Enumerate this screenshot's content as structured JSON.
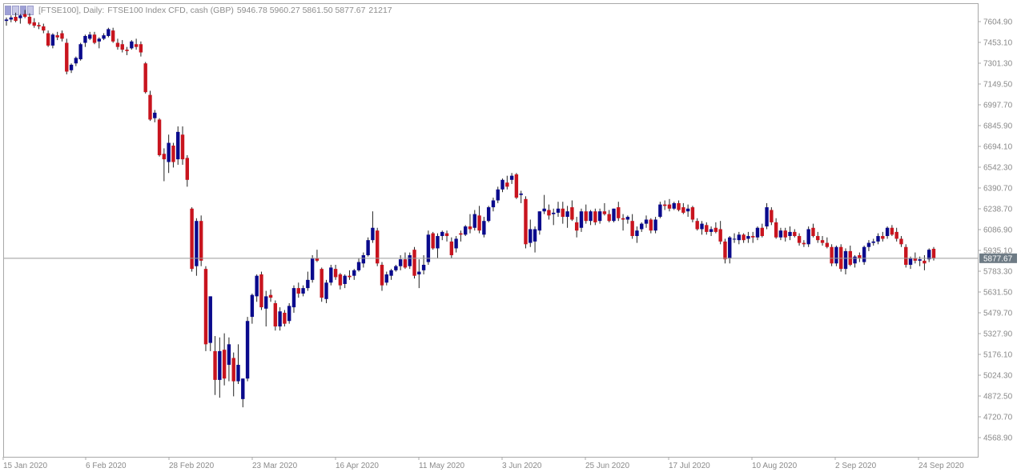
{
  "header": {
    "symbol_period": "[FTSE100], Daily:",
    "description": "FTSE100 Index CFD, cash (GBP)",
    "ohlc": "5946.78 5960.27 5861.50 5877.67",
    "volume": "21217"
  },
  "price_label": "5877.67",
  "colors": {
    "bull": "#0a0a8c",
    "bear": "#c8141e",
    "wick": "#222222",
    "grid_line": "#9a9a9a",
    "price_tag": "#6e7b85"
  },
  "chart_data": {
    "type": "candlestick",
    "title": "FTSE100 Index CFD, cash (GBP)",
    "ylim": [
      4480,
      7700
    ],
    "current_price": 5877.67,
    "y_ticks": [
      "7604.90",
      "7453.10",
      "7301.30",
      "7149.50",
      "6997.70",
      "6845.90",
      "6694.10",
      "6542.30",
      "6390.70",
      "6238.70",
      "6086.90",
      "5935.10",
      "5783.30",
      "5631.50",
      "5479.70",
      "5327.90",
      "5176.10",
      "5024.30",
      "4872.50",
      "4720.70",
      "4568.90"
    ],
    "x_ticks": [
      "15 Jan 2020",
      "6 Feb 2020",
      "28 Feb 2020",
      "23 Mar 2020",
      "16 Apr 2020",
      "11 May 2020",
      "3 Jun 2020",
      "25 Jun 2020",
      "17 Jul 2020",
      "10 Aug 2020",
      "2 Sep 2020",
      "24 Sep 2020"
    ],
    "candles": [
      {
        "o": 7610,
        "h": 7635,
        "l": 7575,
        "c": 7620
      },
      {
        "o": 7620,
        "h": 7650,
        "l": 7600,
        "c": 7635
      },
      {
        "o": 7640,
        "h": 7670,
        "l": 7600,
        "c": 7610
      },
      {
        "o": 7630,
        "h": 7660,
        "l": 7590,
        "c": 7650
      },
      {
        "o": 7660,
        "h": 7690,
        "l": 7630,
        "c": 7640
      },
      {
        "o": 7640,
        "h": 7665,
        "l": 7580,
        "c": 7590
      },
      {
        "o": 7600,
        "h": 7630,
        "l": 7560,
        "c": 7575
      },
      {
        "o": 7580,
        "h": 7600,
        "l": 7550,
        "c": 7570
      },
      {
        "o": 7570,
        "h": 7590,
        "l": 7520,
        "c": 7540
      },
      {
        "o": 7520,
        "h": 7540,
        "l": 7420,
        "c": 7430
      },
      {
        "o": 7430,
        "h": 7520,
        "l": 7410,
        "c": 7510
      },
      {
        "o": 7505,
        "h": 7530,
        "l": 7470,
        "c": 7490
      },
      {
        "o": 7520,
        "h": 7540,
        "l": 7460,
        "c": 7480
      },
      {
        "o": 7450,
        "h": 7480,
        "l": 7220,
        "c": 7240
      },
      {
        "o": 7250,
        "h": 7300,
        "l": 7230,
        "c": 7290
      },
      {
        "o": 7300,
        "h": 7350,
        "l": 7280,
        "c": 7340
      },
      {
        "o": 7330,
        "h": 7450,
        "l": 7320,
        "c": 7440
      },
      {
        "o": 7450,
        "h": 7510,
        "l": 7420,
        "c": 7500
      },
      {
        "o": 7480,
        "h": 7530,
        "l": 7470,
        "c": 7510
      },
      {
        "o": 7510,
        "h": 7530,
        "l": 7440,
        "c": 7450
      },
      {
        "o": 7460,
        "h": 7490,
        "l": 7410,
        "c": 7480
      },
      {
        "o": 7480,
        "h": 7520,
        "l": 7470,
        "c": 7505
      },
      {
        "o": 7500,
        "h": 7560,
        "l": 7490,
        "c": 7550
      },
      {
        "o": 7540,
        "h": 7560,
        "l": 7450,
        "c": 7460
      },
      {
        "o": 7450,
        "h": 7480,
        "l": 7400,
        "c": 7420
      },
      {
        "o": 7440,
        "h": 7470,
        "l": 7380,
        "c": 7400
      },
      {
        "o": 7400,
        "h": 7420,
        "l": 7360,
        "c": 7390
      },
      {
        "o": 7410,
        "h": 7470,
        "l": 7400,
        "c": 7460
      },
      {
        "o": 7440,
        "h": 7480,
        "l": 7400,
        "c": 7420
      },
      {
        "o": 7440,
        "h": 7460,
        "l": 7350,
        "c": 7380
      },
      {
        "o": 7300,
        "h": 7310,
        "l": 7080,
        "c": 7090
      },
      {
        "o": 7070,
        "h": 7100,
        "l": 6880,
        "c": 6890
      },
      {
        "o": 6900,
        "h": 6960,
        "l": 6870,
        "c": 6940
      },
      {
        "o": 6890,
        "h": 6900,
        "l": 6620,
        "c": 6630
      },
      {
        "o": 6640,
        "h": 6680,
        "l": 6440,
        "c": 6600
      },
      {
        "o": 6580,
        "h": 6780,
        "l": 6500,
        "c": 6720
      },
      {
        "o": 6700,
        "h": 6720,
        "l": 6540,
        "c": 6580
      },
      {
        "o": 6600,
        "h": 6840,
        "l": 6560,
        "c": 6800
      },
      {
        "o": 6780,
        "h": 6840,
        "l": 6560,
        "c": 6600
      },
      {
        "o": 6610,
        "h": 6630,
        "l": 6400,
        "c": 6450
      },
      {
        "o": 6240,
        "h": 6250,
        "l": 5780,
        "c": 5800
      },
      {
        "o": 5820,
        "h": 6170,
        "l": 5750,
        "c": 6150
      },
      {
        "o": 6150,
        "h": 6190,
        "l": 5820,
        "c": 5860
      },
      {
        "o": 5800,
        "h": 5820,
        "l": 5200,
        "c": 5250
      },
      {
        "o": 5260,
        "h": 5600,
        "l": 5200,
        "c": 5600
      },
      {
        "o": 5200,
        "h": 5310,
        "l": 4880,
        "c": 4990
      },
      {
        "o": 4990,
        "h": 5300,
        "l": 4860,
        "c": 5200
      },
      {
        "o": 5210,
        "h": 5330,
        "l": 4950,
        "c": 5000
      },
      {
        "o": 5100,
        "h": 5300,
        "l": 4980,
        "c": 5250
      },
      {
        "o": 5150,
        "h": 5190,
        "l": 4870,
        "c": 4980
      },
      {
        "o": 4980,
        "h": 5250,
        "l": 4960,
        "c": 5100
      },
      {
        "o": 4850,
        "h": 5000,
        "l": 4790,
        "c": 5000
      },
      {
        "o": 5000,
        "h": 5450,
        "l": 4980,
        "c": 5420
      },
      {
        "o": 5450,
        "h": 5620,
        "l": 5400,
        "c": 5610
      },
      {
        "o": 5600,
        "h": 5760,
        "l": 5560,
        "c": 5750
      },
      {
        "o": 5760,
        "h": 5780,
        "l": 5500,
        "c": 5520
      },
      {
        "o": 5510,
        "h": 5640,
        "l": 5380,
        "c": 5600
      },
      {
        "o": 5610,
        "h": 5650,
        "l": 5560,
        "c": 5590
      },
      {
        "o": 5550,
        "h": 5570,
        "l": 5350,
        "c": 5380
      },
      {
        "o": 5380,
        "h": 5520,
        "l": 5350,
        "c": 5490
      },
      {
        "o": 5480,
        "h": 5500,
        "l": 5380,
        "c": 5400
      },
      {
        "o": 5420,
        "h": 5550,
        "l": 5400,
        "c": 5530
      },
      {
        "o": 5520,
        "h": 5680,
        "l": 5480,
        "c": 5660
      },
      {
        "o": 5660,
        "h": 5700,
        "l": 5590,
        "c": 5620
      },
      {
        "o": 5620,
        "h": 5680,
        "l": 5600,
        "c": 5660
      },
      {
        "o": 5660,
        "h": 5780,
        "l": 5640,
        "c": 5720
      },
      {
        "o": 5720,
        "h": 5900,
        "l": 5700,
        "c": 5880
      },
      {
        "o": 5880,
        "h": 5940,
        "l": 5850,
        "c": 5860
      },
      {
        "o": 5800,
        "h": 5810,
        "l": 5560,
        "c": 5590
      },
      {
        "o": 5580,
        "h": 5720,
        "l": 5550,
        "c": 5700
      },
      {
        "o": 5700,
        "h": 5830,
        "l": 5680,
        "c": 5810
      },
      {
        "o": 5800,
        "h": 5830,
        "l": 5720,
        "c": 5740
      },
      {
        "o": 5760,
        "h": 5770,
        "l": 5650,
        "c": 5680
      },
      {
        "o": 5690,
        "h": 5760,
        "l": 5660,
        "c": 5750
      },
      {
        "o": 5750,
        "h": 5790,
        "l": 5720,
        "c": 5740
      },
      {
        "o": 5750,
        "h": 5800,
        "l": 5720,
        "c": 5790
      },
      {
        "o": 5790,
        "h": 5880,
        "l": 5780,
        "c": 5850
      },
      {
        "o": 5840,
        "h": 5920,
        "l": 5810,
        "c": 5900
      },
      {
        "o": 5900,
        "h": 6030,
        "l": 5890,
        "c": 6010
      },
      {
        "o": 6010,
        "h": 6220,
        "l": 5990,
        "c": 6100
      },
      {
        "o": 6080,
        "h": 6100,
        "l": 5820,
        "c": 5840
      },
      {
        "o": 5830,
        "h": 5850,
        "l": 5640,
        "c": 5680
      },
      {
        "o": 5700,
        "h": 5780,
        "l": 5680,
        "c": 5760
      },
      {
        "o": 5750,
        "h": 5800,
        "l": 5720,
        "c": 5790
      },
      {
        "o": 5790,
        "h": 5830,
        "l": 5780,
        "c": 5820
      },
      {
        "o": 5820,
        "h": 5900,
        "l": 5790,
        "c": 5870
      },
      {
        "o": 5870,
        "h": 5920,
        "l": 5800,
        "c": 5810
      },
      {
        "o": 5820,
        "h": 5920,
        "l": 5800,
        "c": 5900
      },
      {
        "o": 5940,
        "h": 5960,
        "l": 5730,
        "c": 5750
      },
      {
        "o": 5760,
        "h": 5870,
        "l": 5660,
        "c": 5780
      },
      {
        "o": 5790,
        "h": 5900,
        "l": 5760,
        "c": 5830
      },
      {
        "o": 5850,
        "h": 6080,
        "l": 5830,
        "c": 6050
      },
      {
        "o": 6060,
        "h": 6070,
        "l": 5940,
        "c": 5950
      },
      {
        "o": 5950,
        "h": 6060,
        "l": 5880,
        "c": 6040
      },
      {
        "o": 6040,
        "h": 6080,
        "l": 6010,
        "c": 6070
      },
      {
        "o": 6060,
        "h": 6080,
        "l": 6000,
        "c": 6040
      },
      {
        "o": 6000,
        "h": 6030,
        "l": 5880,
        "c": 5900
      },
      {
        "o": 5950,
        "h": 6040,
        "l": 5920,
        "c": 6020
      },
      {
        "o": 6060,
        "h": 6080,
        "l": 6000,
        "c": 6050
      },
      {
        "o": 6050,
        "h": 6120,
        "l": 6040,
        "c": 6110
      },
      {
        "o": 6110,
        "h": 6200,
        "l": 6060,
        "c": 6090
      },
      {
        "o": 6100,
        "h": 6230,
        "l": 6080,
        "c": 6200
      },
      {
        "o": 6190,
        "h": 6260,
        "l": 6060,
        "c": 6080
      },
      {
        "o": 6050,
        "h": 6180,
        "l": 6030,
        "c": 6150
      },
      {
        "o": 6150,
        "h": 6260,
        "l": 6140,
        "c": 6250
      },
      {
        "o": 6250,
        "h": 6320,
        "l": 6220,
        "c": 6300
      },
      {
        "o": 6300,
        "h": 6400,
        "l": 6280,
        "c": 6380
      },
      {
        "o": 6380,
        "h": 6460,
        "l": 6360,
        "c": 6450
      },
      {
        "o": 6430,
        "h": 6480,
        "l": 6380,
        "c": 6400
      },
      {
        "o": 6450,
        "h": 6500,
        "l": 6420,
        "c": 6480
      },
      {
        "o": 6490,
        "h": 6500,
        "l": 6310,
        "c": 6320
      },
      {
        "o": 6340,
        "h": 6370,
        "l": 6280,
        "c": 6350
      },
      {
        "o": 6310,
        "h": 6330,
        "l": 5950,
        "c": 5980
      },
      {
        "o": 5990,
        "h": 6160,
        "l": 5960,
        "c": 6090
      },
      {
        "o": 6000,
        "h": 6110,
        "l": 5920,
        "c": 6090
      },
      {
        "o": 6080,
        "h": 6220,
        "l": 6050,
        "c": 6220
      },
      {
        "o": 6220,
        "h": 6340,
        "l": 6200,
        "c": 6240
      },
      {
        "o": 6230,
        "h": 6270,
        "l": 6160,
        "c": 6190
      },
      {
        "o": 6200,
        "h": 6240,
        "l": 6120,
        "c": 6210
      },
      {
        "o": 6210,
        "h": 6290,
        "l": 6180,
        "c": 6240
      },
      {
        "o": 6240,
        "h": 6290,
        "l": 6130,
        "c": 6180
      },
      {
        "o": 6180,
        "h": 6260,
        "l": 6100,
        "c": 6220
      },
      {
        "o": 6250,
        "h": 6300,
        "l": 6150,
        "c": 6160
      },
      {
        "o": 6140,
        "h": 6180,
        "l": 6030,
        "c": 6080
      },
      {
        "o": 6100,
        "h": 6240,
        "l": 6070,
        "c": 6220
      },
      {
        "o": 6220,
        "h": 6270,
        "l": 6130,
        "c": 6150
      },
      {
        "o": 6150,
        "h": 6230,
        "l": 6120,
        "c": 6220
      },
      {
        "o": 6220,
        "h": 6240,
        "l": 6120,
        "c": 6140
      },
      {
        "o": 6150,
        "h": 6240,
        "l": 6130,
        "c": 6220
      },
      {
        "o": 6220,
        "h": 6280,
        "l": 6190,
        "c": 6200
      },
      {
        "o": 6200,
        "h": 6230,
        "l": 6140,
        "c": 6150
      },
      {
        "o": 6150,
        "h": 6240,
        "l": 6140,
        "c": 6240
      },
      {
        "o": 6250,
        "h": 6290,
        "l": 6150,
        "c": 6170
      },
      {
        "o": 6170,
        "h": 6200,
        "l": 6080,
        "c": 6160
      },
      {
        "o": 6160,
        "h": 6190,
        "l": 6130,
        "c": 6180
      },
      {
        "o": 6150,
        "h": 6200,
        "l": 6020,
        "c": 6040
      },
      {
        "o": 6040,
        "h": 6110,
        "l": 5990,
        "c": 6080
      },
      {
        "o": 6090,
        "h": 6140,
        "l": 6070,
        "c": 6130
      },
      {
        "o": 6130,
        "h": 6190,
        "l": 6100,
        "c": 6160
      },
      {
        "o": 6160,
        "h": 6170,
        "l": 6060,
        "c": 6080
      },
      {
        "o": 6080,
        "h": 6180,
        "l": 6060,
        "c": 6160
      },
      {
        "o": 6180,
        "h": 6290,
        "l": 6170,
        "c": 6270
      },
      {
        "o": 6270,
        "h": 6300,
        "l": 6230,
        "c": 6260
      },
      {
        "o": 6270,
        "h": 6310,
        "l": 6220,
        "c": 6240
      },
      {
        "o": 6240,
        "h": 6290,
        "l": 6230,
        "c": 6280
      },
      {
        "o": 6280,
        "h": 6300,
        "l": 6220,
        "c": 6230
      },
      {
        "o": 6250,
        "h": 6280,
        "l": 6200,
        "c": 6210
      },
      {
        "o": 6220,
        "h": 6270,
        "l": 6180,
        "c": 6240
      },
      {
        "o": 6250,
        "h": 6260,
        "l": 6140,
        "c": 6160
      },
      {
        "o": 6150,
        "h": 6170,
        "l": 6080,
        "c": 6090
      },
      {
        "o": 6090,
        "h": 6150,
        "l": 6050,
        "c": 6130
      },
      {
        "o": 6120,
        "h": 6140,
        "l": 6050,
        "c": 6070
      },
      {
        "o": 6070,
        "h": 6110,
        "l": 6040,
        "c": 6090
      },
      {
        "o": 6100,
        "h": 6140,
        "l": 6060,
        "c": 6070
      },
      {
        "o": 6090,
        "h": 6150,
        "l": 5980,
        "c": 6000
      },
      {
        "o": 6000,
        "h": 6020,
        "l": 5840,
        "c": 5870
      },
      {
        "o": 5880,
        "h": 6040,
        "l": 5840,
        "c": 6030
      },
      {
        "o": 6020,
        "h": 6060,
        "l": 5990,
        "c": 6020
      },
      {
        "o": 6010,
        "h": 6070,
        "l": 5980,
        "c": 6050
      },
      {
        "o": 6050,
        "h": 6060,
        "l": 5990,
        "c": 6010
      },
      {
        "o": 6020,
        "h": 6070,
        "l": 5990,
        "c": 6040
      },
      {
        "o": 6040,
        "h": 6070,
        "l": 5990,
        "c": 6030
      },
      {
        "o": 6030,
        "h": 6110,
        "l": 6010,
        "c": 6100
      },
      {
        "o": 6100,
        "h": 6130,
        "l": 6030,
        "c": 6040
      },
      {
        "o": 6110,
        "h": 6280,
        "l": 6090,
        "c": 6250
      },
      {
        "o": 6230,
        "h": 6250,
        "l": 6120,
        "c": 6140
      },
      {
        "o": 6140,
        "h": 6170,
        "l": 6020,
        "c": 6030
      },
      {
        "o": 6030,
        "h": 6100,
        "l": 6010,
        "c": 6080
      },
      {
        "o": 6080,
        "h": 6100,
        "l": 6000,
        "c": 6030
      },
      {
        "o": 6040,
        "h": 6110,
        "l": 6010,
        "c": 6070
      },
      {
        "o": 6070,
        "h": 6090,
        "l": 6030,
        "c": 6040
      },
      {
        "o": 6040,
        "h": 6060,
        "l": 5970,
        "c": 5990
      },
      {
        "o": 5990,
        "h": 6010,
        "l": 5960,
        "c": 5980
      },
      {
        "o": 5980,
        "h": 6110,
        "l": 5960,
        "c": 6090
      },
      {
        "o": 6100,
        "h": 6130,
        "l": 6030,
        "c": 6040
      },
      {
        "o": 6040,
        "h": 6070,
        "l": 5990,
        "c": 6010
      },
      {
        "o": 6010,
        "h": 6040,
        "l": 5970,
        "c": 5990
      },
      {
        "o": 5990,
        "h": 6030,
        "l": 5950,
        "c": 5960
      },
      {
        "o": 5960,
        "h": 5980,
        "l": 5820,
        "c": 5840
      },
      {
        "o": 5840,
        "h": 5970,
        "l": 5820,
        "c": 5960
      },
      {
        "o": 5960,
        "h": 5980,
        "l": 5780,
        "c": 5800
      },
      {
        "o": 5800,
        "h": 5950,
        "l": 5760,
        "c": 5930
      },
      {
        "o": 5930,
        "h": 5970,
        "l": 5820,
        "c": 5830
      },
      {
        "o": 5840,
        "h": 5900,
        "l": 5810,
        "c": 5890
      },
      {
        "o": 5900,
        "h": 5920,
        "l": 5850,
        "c": 5880
      },
      {
        "o": 5850,
        "h": 5970,
        "l": 5830,
        "c": 5960
      },
      {
        "o": 5960,
        "h": 6010,
        "l": 5930,
        "c": 5990
      },
      {
        "o": 5990,
        "h": 6020,
        "l": 5970,
        "c": 6000
      },
      {
        "o": 6000,
        "h": 6060,
        "l": 5980,
        "c": 6040
      },
      {
        "o": 6040,
        "h": 6070,
        "l": 6000,
        "c": 6020
      },
      {
        "o": 6040,
        "h": 6110,
        "l": 6020,
        "c": 6100
      },
      {
        "o": 6100,
        "h": 6120,
        "l": 6040,
        "c": 6050
      },
      {
        "o": 6070,
        "h": 6100,
        "l": 6000,
        "c": 6020
      },
      {
        "o": 6020,
        "h": 6040,
        "l": 5960,
        "c": 5980
      },
      {
        "o": 5960,
        "h": 5980,
        "l": 5810,
        "c": 5830
      },
      {
        "o": 5830,
        "h": 5890,
        "l": 5800,
        "c": 5880
      },
      {
        "o": 5880,
        "h": 5920,
        "l": 5840,
        "c": 5860
      },
      {
        "o": 5860,
        "h": 5890,
        "l": 5820,
        "c": 5870
      },
      {
        "o": 5860,
        "h": 5900,
        "l": 5790,
        "c": 5840
      },
      {
        "o": 5870,
        "h": 5950,
        "l": 5850,
        "c": 5940
      },
      {
        "o": 5946.78,
        "h": 5960.27,
        "l": 5861.5,
        "c": 5877.67
      }
    ]
  }
}
